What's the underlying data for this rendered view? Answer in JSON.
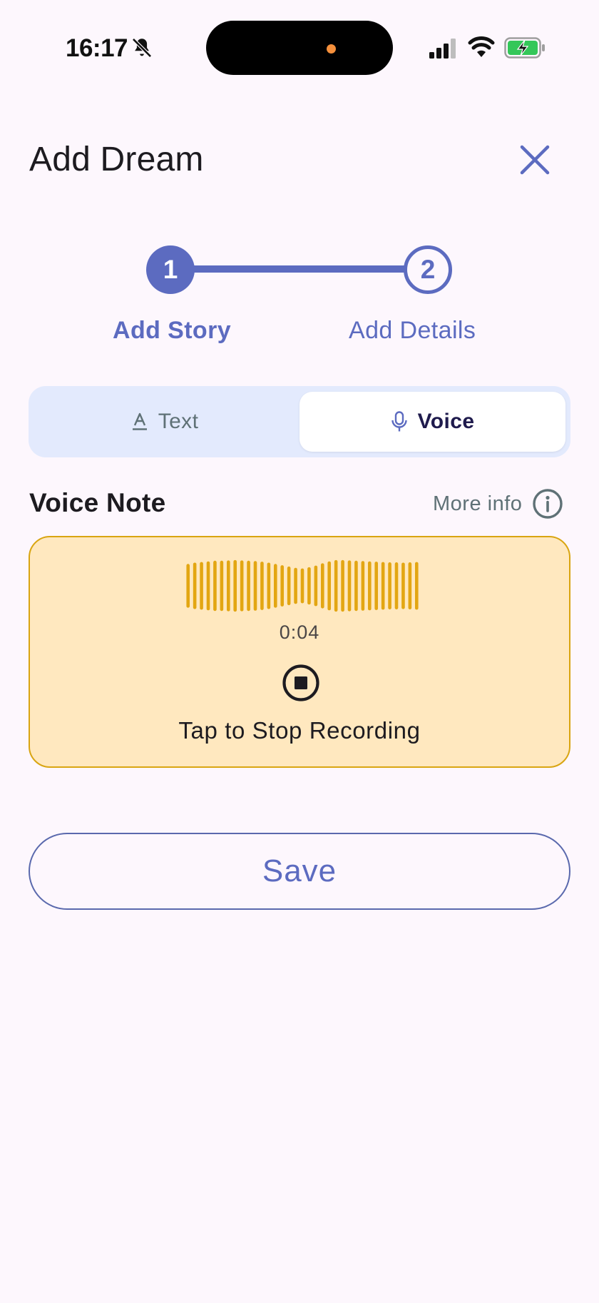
{
  "status_bar": {
    "time": "16:17",
    "icons": [
      "bell-off-icon",
      "signal-icon",
      "wifi-icon",
      "battery-charging-icon"
    ]
  },
  "header": {
    "title": "Add Dream",
    "close_icon": "close-icon"
  },
  "stepper": {
    "steps": [
      {
        "number": "1",
        "label": "Add Story",
        "state": "active"
      },
      {
        "number": "2",
        "label": "Add Details",
        "state": "upcoming"
      }
    ]
  },
  "mode_toggle": {
    "options": [
      {
        "label": "Text",
        "icon": "text-format-icon",
        "selected": false
      },
      {
        "label": "Voice",
        "icon": "microphone-icon",
        "selected": true
      }
    ]
  },
  "voice_note": {
    "title": "Voice Note",
    "more_info_label": "More info",
    "more_info_icon": "info-icon",
    "recorder": {
      "elapsed": "0:04",
      "stop_label": "Tap to Stop Recording",
      "stop_icon": "stop-circle-icon",
      "waveform_levels": [
        0.68,
        0.72,
        0.74,
        0.76,
        0.78,
        0.78,
        0.79,
        0.8,
        0.79,
        0.78,
        0.77,
        0.75,
        0.72,
        0.68,
        0.64,
        0.6,
        0.56,
        0.54,
        0.58,
        0.63,
        0.7,
        0.76,
        0.8,
        0.8,
        0.79,
        0.78,
        0.77,
        0.76,
        0.75,
        0.74,
        0.73,
        0.73,
        0.72,
        0.73,
        0.74
      ]
    }
  },
  "actions": {
    "save_label": "Save"
  },
  "colors": {
    "primary": "#5c6bc0",
    "background": "#fdf7fd",
    "toggle_track": "#e3eafd",
    "recording_bg": "#ffe8bf",
    "recording_border": "#d9a511",
    "waveform": "#e3a612"
  }
}
